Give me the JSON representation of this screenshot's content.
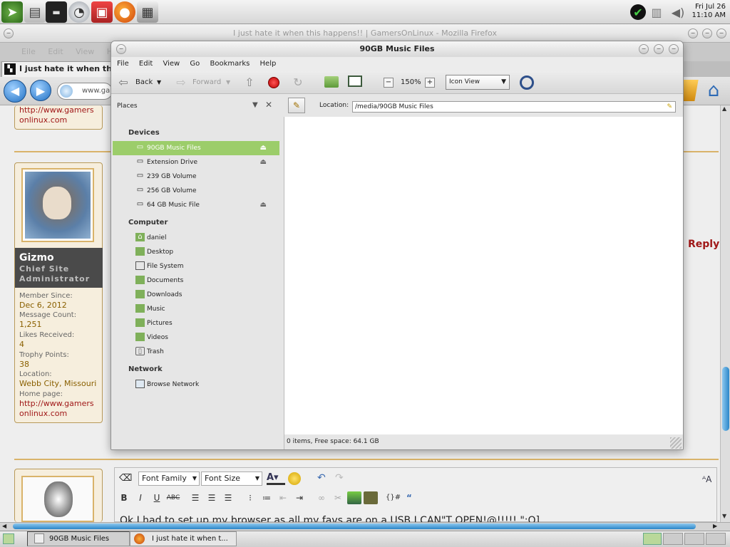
{
  "clock": {
    "date": "Fri Jul 26",
    "time": "11:10 AM"
  },
  "firefox": {
    "title": "I just hate it when this happens!! | GamersOnLinux - Mozilla Firefox",
    "tab_title": "I just hate it when this h",
    "url_partial": "www.gan",
    "menu_partial": "Eile  Edit  View  History  Bo",
    "post": {
      "prev_homepage_link": "http://www.gamers\nonlinux.com",
      "username": "Gizmo",
      "user_title": "Chief Site Administrator",
      "member_since_label": "Member Since:",
      "member_since": "Dec 6, 2012",
      "message_count_label": "Message Count:",
      "message_count": "1,251",
      "likes_label": "Likes Received:",
      "likes": "4",
      "trophy_label": "Trophy Points:",
      "trophy": "38",
      "location_label": "Location:",
      "location": "Webb City, Missouri",
      "homepage_label": "Home page:",
      "homepage": "http://www.gamers\nonlinux.com",
      "reply_label": "Reply"
    },
    "editor": {
      "font_family": "Font Family",
      "font_size": "Font Size",
      "text_partial": "Ok I had to set up my browser as all my favs are on a USB I CAN\"T OPEN!@!!!!! \":O]"
    }
  },
  "taskbar": {
    "items": [
      {
        "label": "90GB Music Files"
      },
      {
        "label": "I just hate it when t..."
      }
    ]
  },
  "nautilus": {
    "title": "90GB Music Files",
    "menu": [
      "File",
      "Edit",
      "View",
      "Go",
      "Bookmarks",
      "Help"
    ],
    "toolbar": {
      "back": "Back",
      "forward": "Forward",
      "zoom": "150%",
      "view_mode": "Icon View"
    },
    "places_label": "Places",
    "location_label": "Location:",
    "location": "/media/90GB Music Files",
    "sections": {
      "devices": "Devices",
      "computer": "Computer",
      "network": "Network"
    },
    "devices": [
      {
        "label": "90GB Music Files",
        "eject": true
      },
      {
        "label": "Extension Drive",
        "eject": true
      },
      {
        "label": "239 GB Volume",
        "eject": false
      },
      {
        "label": "256 GB Volume",
        "eject": false
      },
      {
        "label": "64 GB Music File",
        "eject": true
      }
    ],
    "computer": [
      {
        "label": "daniel"
      },
      {
        "label": "Desktop"
      },
      {
        "label": "File System"
      },
      {
        "label": "Documents"
      },
      {
        "label": "Downloads"
      },
      {
        "label": "Music"
      },
      {
        "label": "Pictures"
      },
      {
        "label": "Videos"
      },
      {
        "label": "Trash"
      }
    ],
    "network": [
      {
        "label": "Browse Network"
      }
    ],
    "status": "0 items, Free space: 64.1 GB"
  }
}
